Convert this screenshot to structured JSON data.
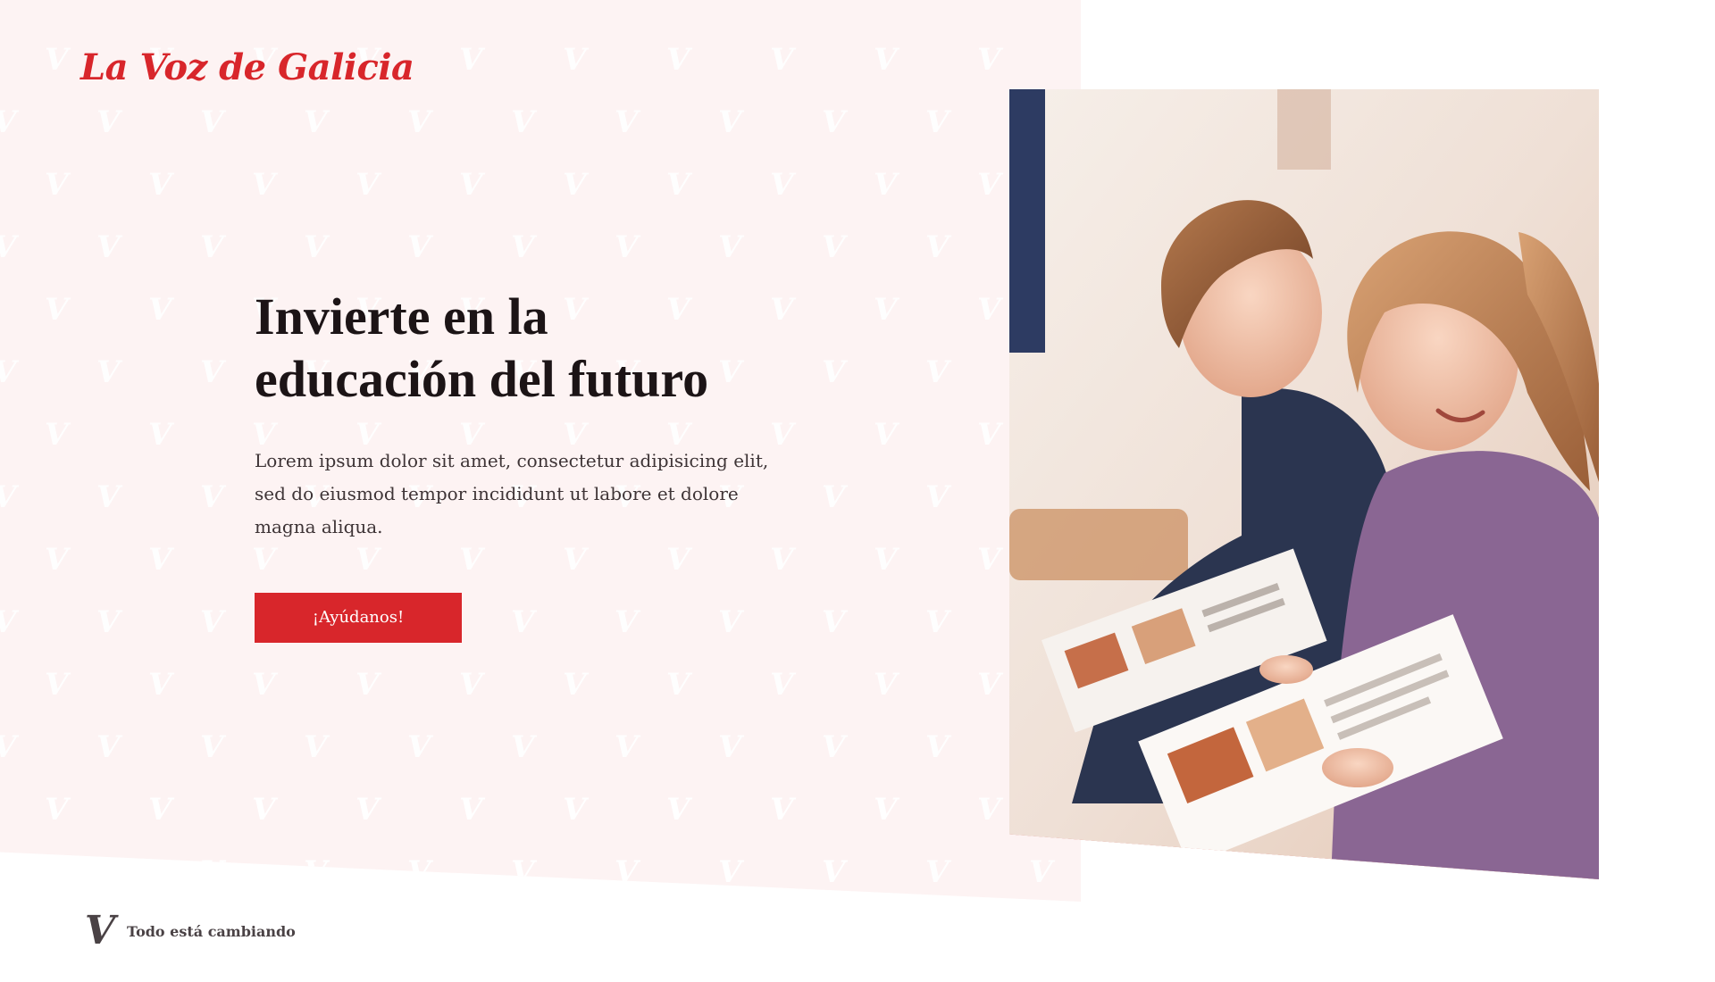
{
  "brand": {
    "logo_text": "La Voz de Galicia",
    "pattern_glyph": "V",
    "footer_mark_glyph": "V",
    "tagline": "Todo está cambiando",
    "colors": {
      "accent": "#d8262b",
      "panel_background": "#fdf3f3",
      "heading": "#1c1416",
      "body": "#3e3436"
    }
  },
  "hero": {
    "headline_line1": "Invierte en la",
    "headline_line2": "educación del futuro",
    "body": "Lorem ipsum dolor sit amet, consectetur adipisicing elit, sed do eiusmod tempor incididunt ut labore et dolore magna aliqua.",
    "cta_label": "¡Ayúdanos!"
  },
  "image": {
    "subject_icon": "photo-children-reading-newspaper"
  }
}
